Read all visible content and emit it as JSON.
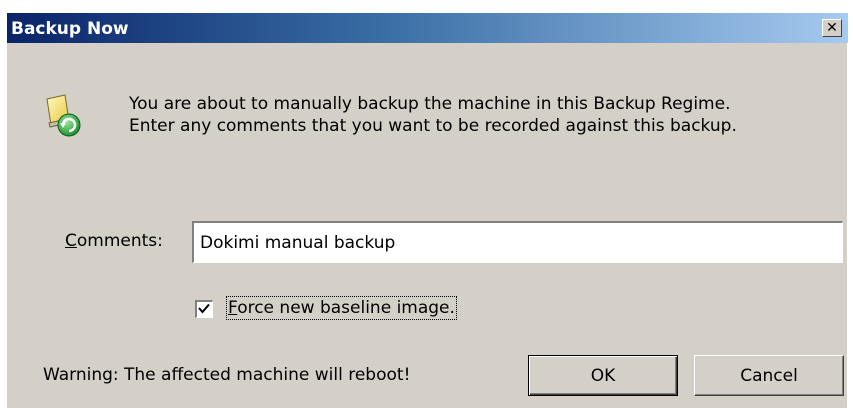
{
  "window": {
    "title": "Backup Now",
    "close_glyph": "✕"
  },
  "icon": "backup-machine-icon",
  "intro": {
    "line1": "You are about to manually backup the machine in this Backup Regime.",
    "line2": "Enter any comments that you want to be recorded against this backup."
  },
  "comments": {
    "label_accel": "C",
    "label_rest": "omments:",
    "value": "Dokimi manual backup"
  },
  "force_baseline": {
    "checked": true,
    "label_accel": "F",
    "label_rest": "orce new baseline image."
  },
  "warning": "Warning: The affected machine will reboot!",
  "buttons": {
    "ok": "OK",
    "cancel": "Cancel"
  },
  "colors": {
    "dialog_bg": "#d4d0c8",
    "title_gradient_start": "#0a246a",
    "title_gradient_end": "#a6caf0"
  }
}
